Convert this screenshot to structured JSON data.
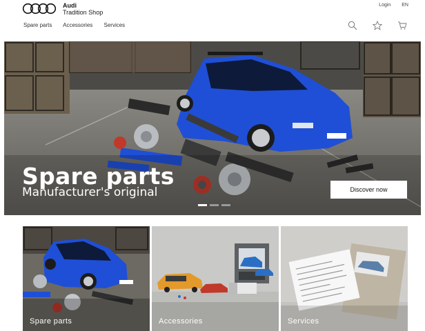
{
  "brand": {
    "name": "Audi",
    "shop": "Tradition Shop"
  },
  "top_links": {
    "login": "Login",
    "language": "EN"
  },
  "nav": {
    "items": [
      "Spare parts",
      "Accessories",
      "Services"
    ]
  },
  "header_icons": [
    "search-icon",
    "star-icon",
    "cart-icon"
  ],
  "hero": {
    "title": "Spare parts",
    "subtitle": "Manufacturer's original",
    "cta": "Discover now",
    "slides_total": 3,
    "active_slide": 1
  },
  "tiles": [
    {
      "label": "Spare parts"
    },
    {
      "label": "Accessories"
    },
    {
      "label": "Services"
    }
  ],
  "colors": {
    "car_blue": "#1f4fd6",
    "text_dark": "#1a1a1a",
    "button_bg": "#ffffff"
  }
}
